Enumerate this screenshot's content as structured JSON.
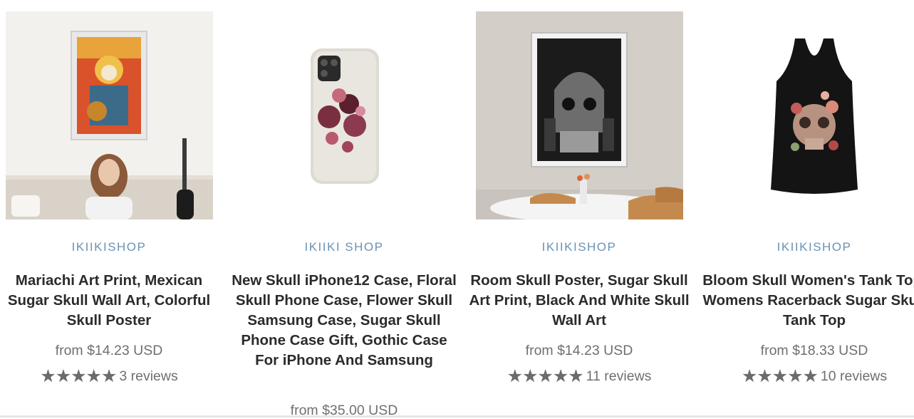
{
  "products": [
    {
      "vendor": "IKIIKISHOP",
      "title": "Mariachi Art Print, Mexican Sugar Skull Wall Art, Colorful Skull Poster",
      "price": "from $14.23 USD",
      "stars": "★★★★★",
      "reviews": "3 reviews",
      "image_icon": "skull-poster-living-room-image"
    },
    {
      "vendor": "IKIIKI SHOP",
      "title": "New Skull iPhone12 Case, Floral Skull Phone Case, Flower Skull Samsung Case, Sugar Skull Phone Case Gift, Gothic Case For iPhone And Samsung",
      "price": "from $35.00 USD",
      "image_icon": "floral-skull-phone-case-image"
    },
    {
      "vendor": "IKIIKISHOP",
      "title": "Room Skull Poster, Sugar Skull Art Print, Black And White Skull Wall Art",
      "price": "from $14.23 USD",
      "stars": "★★★★★",
      "reviews": "11 reviews",
      "image_icon": "room-skull-poster-image"
    },
    {
      "vendor": "IKIIKISHOP",
      "title": "Bloom Skull Women's Tank Top, Womens Racerback Sugar Skull Tank Top",
      "price": "from $18.33 USD",
      "stars": "★★★★★",
      "reviews": "10 reviews",
      "image_icon": "floral-skull-tank-top-image"
    }
  ],
  "colors": {
    "vendor": "#6a93b5",
    "title": "#2b2b2b",
    "price": "#6f6f6f",
    "stars": "#6b6b6b"
  }
}
